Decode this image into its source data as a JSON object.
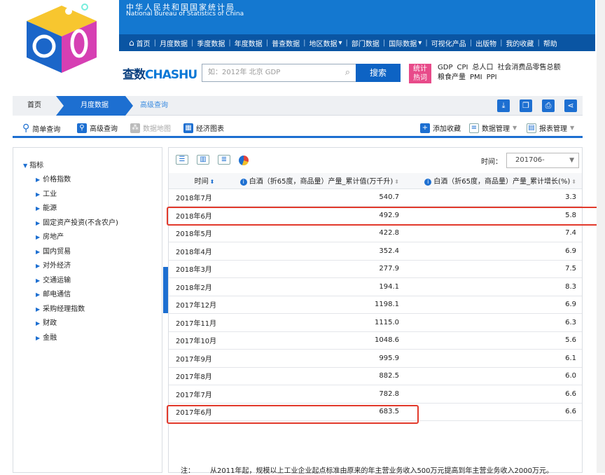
{
  "header": {
    "cn_name": "中华人民共和国国家统计局",
    "en_name": "National Bureau of Statistics of China",
    "nav": [
      {
        "label": "首页",
        "icon": "home-icon"
      },
      {
        "label": "月度数据"
      },
      {
        "label": "季度数据"
      },
      {
        "label": "年度数据"
      },
      {
        "label": "普查数据"
      },
      {
        "label": "地区数据",
        "dropdown": true
      },
      {
        "label": "部门数据"
      },
      {
        "label": "国际数据",
        "dropdown": true
      },
      {
        "label": "可视化产品"
      },
      {
        "label": "出版物"
      },
      {
        "label": "我的收藏"
      },
      {
        "label": "帮助"
      }
    ]
  },
  "search": {
    "brand_a": "查数",
    "brand_b": "CHASHU",
    "placeholder": "如：2012年 北京 GDP",
    "button": "搜索",
    "hot_label": "统计热词",
    "hot_words": [
      "GDP",
      "CPI",
      "总人口",
      "社会消费品零售总额",
      "粮食产量",
      "PMI",
      "PPI"
    ]
  },
  "breadcrumb": [
    "首页",
    "月度数据",
    "高级查询"
  ],
  "toolbar": {
    "simple_query": "简单查询",
    "advanced_query": "高级查询",
    "data_map": "数据地图",
    "econ_chart": "经济图表",
    "add_favorite": "添加收藏",
    "data_manage": "数据管理",
    "report_manage": "报表管理"
  },
  "sidebar": {
    "root": "指标",
    "items": [
      "价格指数",
      "工业",
      "能源",
      "固定资产投资(不含农户)",
      "房地产",
      "国内贸易",
      "对外经济",
      "交通运输",
      "邮电通信",
      "采购经理指数",
      "财政",
      "金融"
    ]
  },
  "time_filter": {
    "label": "时间：",
    "value": "201706-"
  },
  "table": {
    "headers": [
      "时间",
      "白酒（折65度，商品量）产量_累计值(万千升)",
      "白酒（折65度，商品量）产量_累计增长(%)"
    ],
    "rows": [
      [
        "2018年7月",
        "540.7",
        "3.3"
      ],
      [
        "2018年6月",
        "492.9",
        "5.8"
      ],
      [
        "2018年5月",
        "422.8",
        "7.4"
      ],
      [
        "2018年4月",
        "352.4",
        "6.9"
      ],
      [
        "2018年3月",
        "277.9",
        "7.5"
      ],
      [
        "2018年2月",
        "194.1",
        "8.3"
      ],
      [
        "2017年12月",
        "1198.1",
        "6.9"
      ],
      [
        "2017年11月",
        "1115.0",
        "6.3"
      ],
      [
        "2017年10月",
        "1048.6",
        "5.6"
      ],
      [
        "2017年9月",
        "995.9",
        "6.1"
      ],
      [
        "2017年8月",
        "882.5",
        "6.0"
      ],
      [
        "2017年7月",
        "782.8",
        "6.6"
      ],
      [
        "2017年6月",
        "683.5",
        "6.6"
      ]
    ]
  },
  "note": {
    "label": "注：",
    "text": "从2011年起，规模以上工业企业起点标准由原来的年主营业务收入500万元提高到年主营业务收入2000万元。"
  },
  "colors": {
    "primary": "#1d6fd1",
    "header_blue": "#1478d0",
    "nav_blue": "#0a55a3",
    "highlight": "#e23a2c",
    "hot_pink": "#e84b8a"
  }
}
